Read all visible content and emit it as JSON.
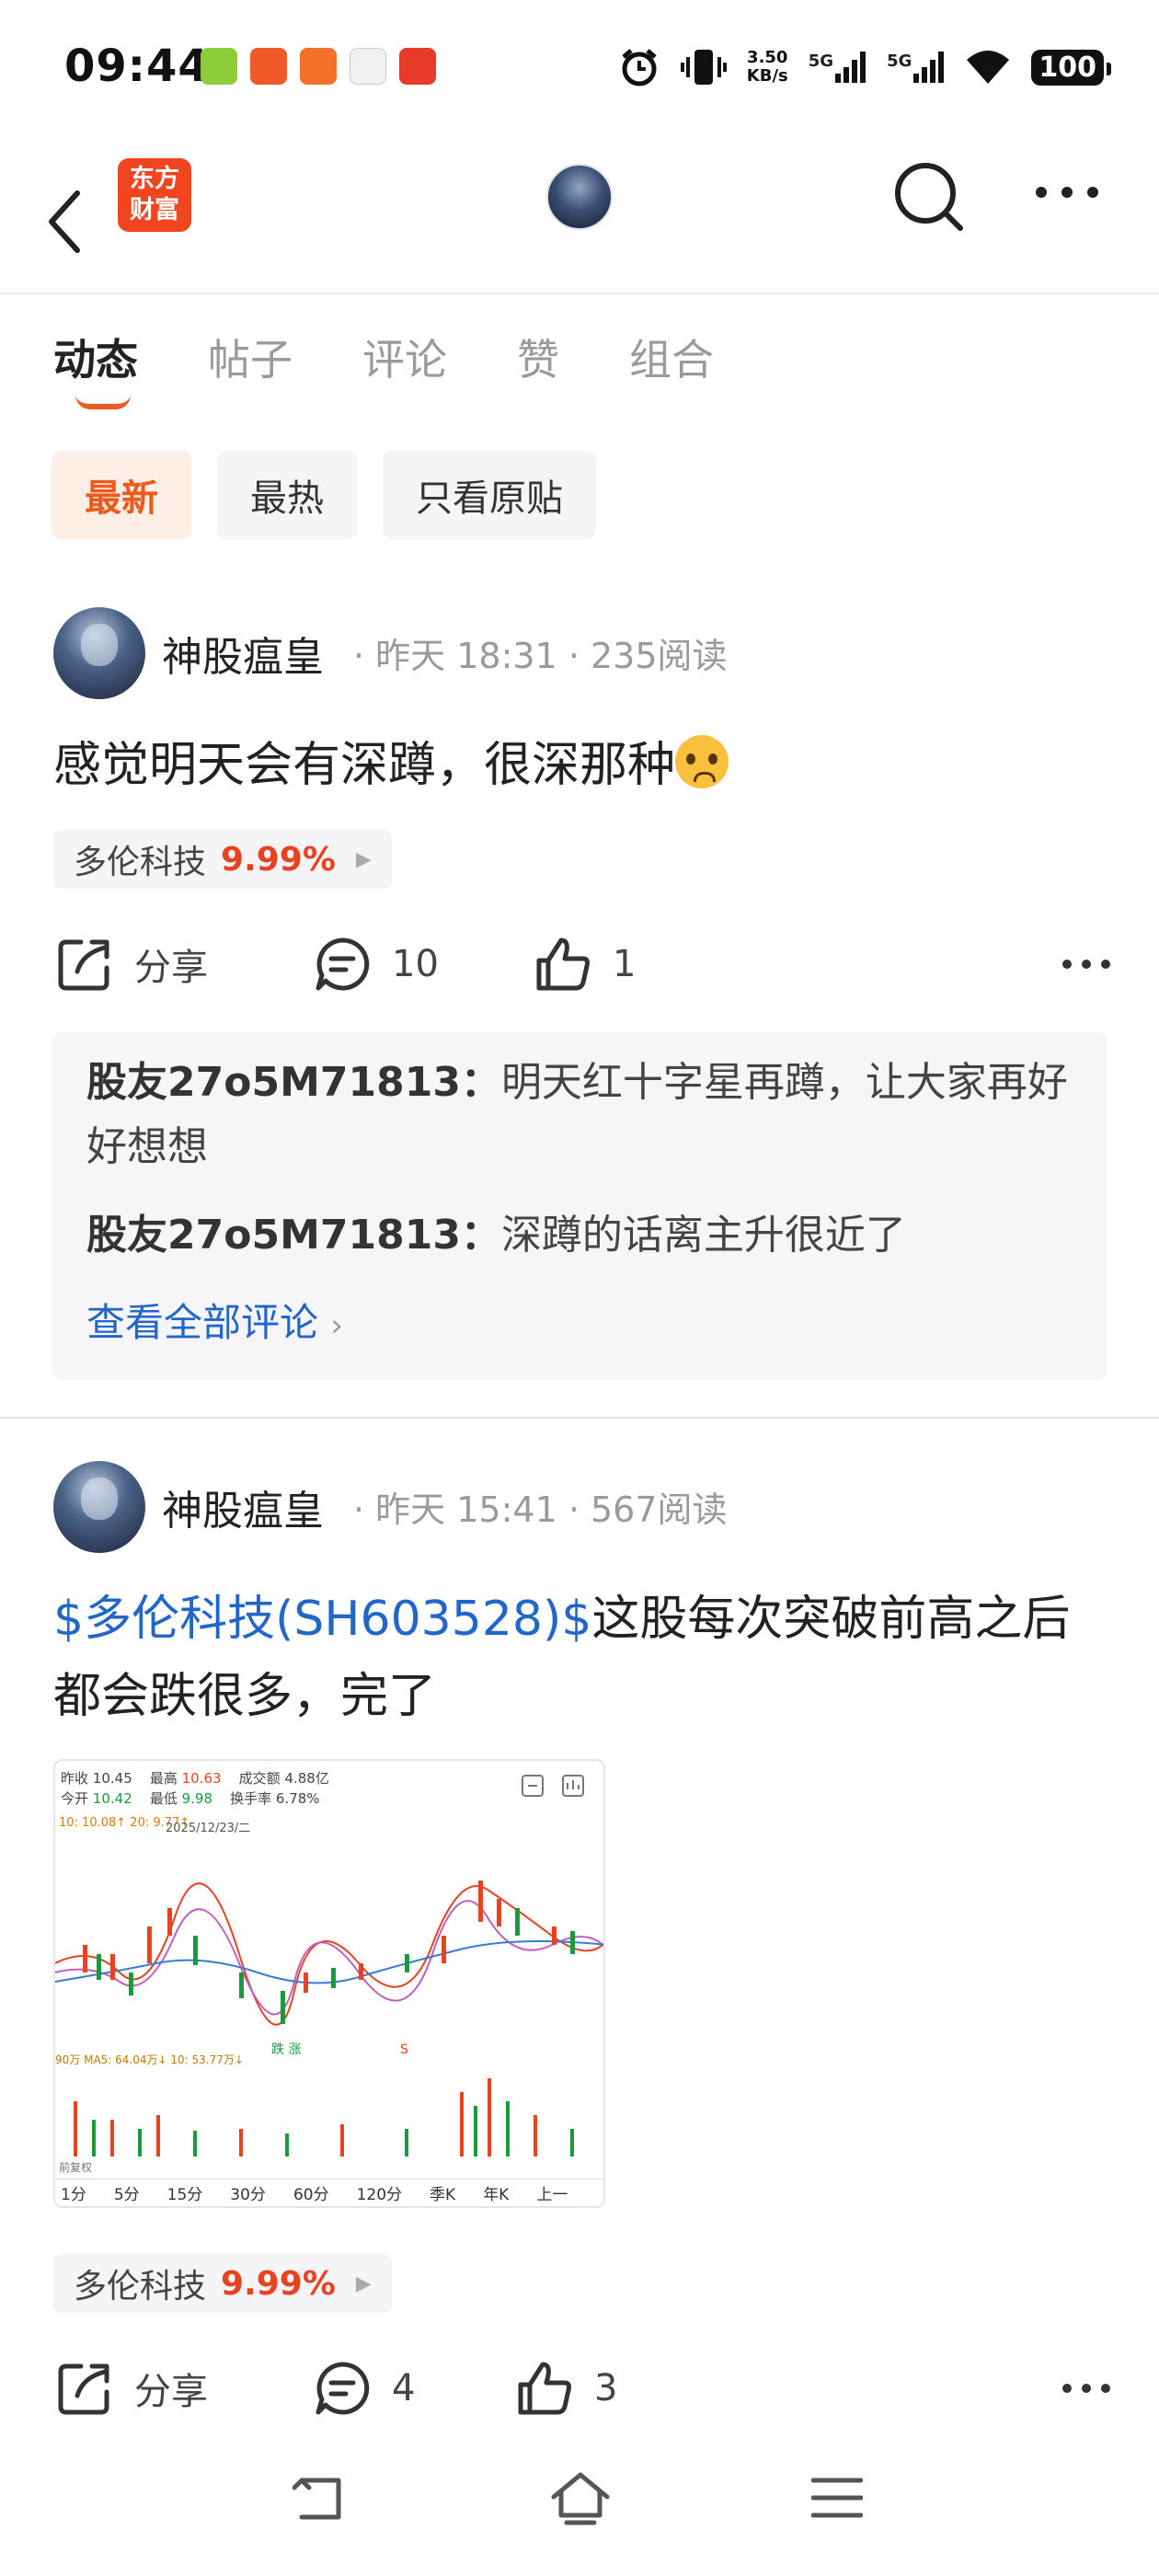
{
  "status_bar": {
    "time": "09:44",
    "net_speed_top": "3.50",
    "net_speed_bottom": "KB/s",
    "signal1": "5G",
    "signal2": "5G",
    "battery": "100"
  },
  "header": {
    "logo_line1": "东方",
    "logo_line2": "财富"
  },
  "tabs": [
    "动态",
    "帖子",
    "评论",
    "赞",
    "组合"
  ],
  "filters": [
    "最新",
    "最热",
    "只看原贴"
  ],
  "posts": [
    {
      "author": "神股瘟皇",
      "meta": "· 昨天 18:31 · 235阅读",
      "text": "感觉明天会有深蹲，很深那种",
      "stock_name": "多伦科技",
      "stock_pct": "9.99%",
      "share_label": "分享",
      "comment_count": "10",
      "like_count": "1",
      "comments": [
        {
          "user": "股友27o5M71813：",
          "text": "明天红十字星再蹲，让大家再好好想想"
        },
        {
          "user": "股友27o5M71813：",
          "text": "深蹲的话离主升很近了"
        }
      ],
      "view_all": "查看全部评论"
    },
    {
      "author": "神股瘟皇",
      "meta": "· 昨天 15:41 · 567阅读",
      "link_text": "$多伦科技(SH603528)$",
      "text": "这股每次突破前高之后都会跌很多，完了",
      "stock_name": "多伦科技",
      "stock_pct": "9.99%",
      "share_label": "分享",
      "comment_count": "4",
      "like_count": "3",
      "chart_thumb": {
        "prev_close_label": "昨收",
        "prev_close": "10.45",
        "high_label": "最高",
        "high": "10.63",
        "volume_label": "成交额",
        "volume": "4.88亿",
        "open_label": "今开",
        "open": "10.42",
        "low_label": "最低",
        "low": "9.98",
        "turnover_label": "换手率",
        "turnover": "6.78%",
        "date": "2025/12/23/二",
        "ma_line": "10: 10.08↑ 20: 9.77↑",
        "vol_line": "90万 MA5: 64.04万↓ 10: 53.77万↓",
        "fuquan": "前复权",
        "periods": [
          "1分",
          "5分",
          "15分",
          "30分",
          "60分",
          "120分",
          "季K",
          "年K",
          "上一"
        ]
      }
    }
  ],
  "colors": {
    "accent": "#ec5a1c",
    "link": "#2166c8",
    "up": "#e8421f",
    "down": "#1a9a3a"
  }
}
